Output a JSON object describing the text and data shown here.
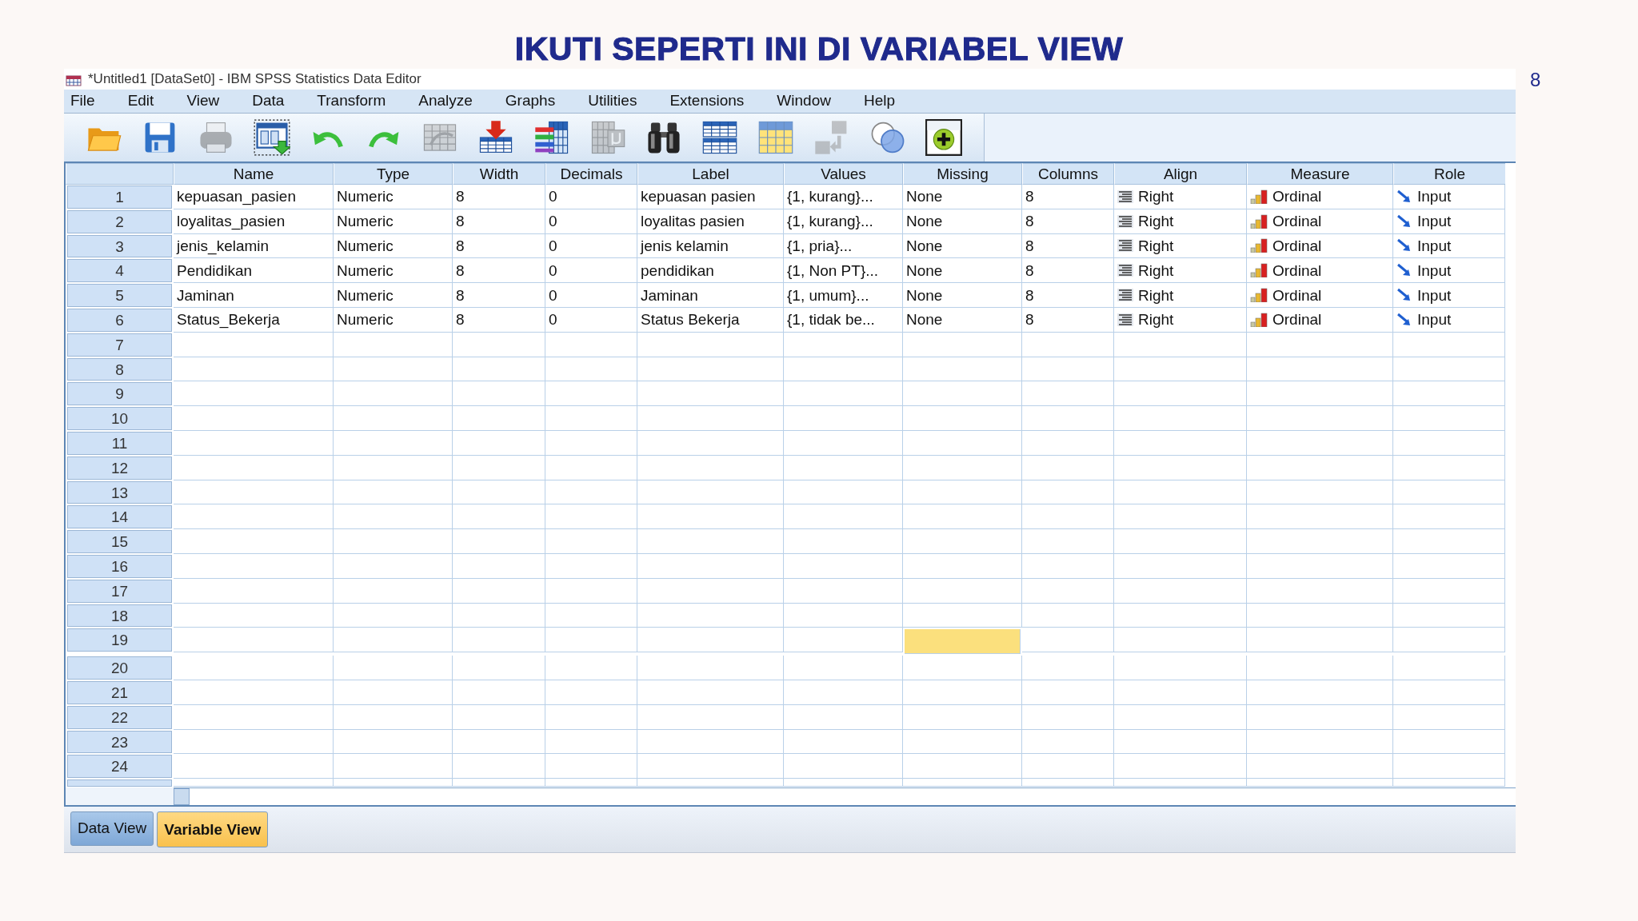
{
  "slide": {
    "heading": "IKUTI SEPERTI INI DI VARIABEL VIEW",
    "page_number": "8"
  },
  "window": {
    "title": "*Untitled1 [DataSet0] - IBM SPSS Statistics Data Editor"
  },
  "menu": [
    "File",
    "Edit",
    "View",
    "Data",
    "Transform",
    "Analyze",
    "Graphs",
    "Utilities",
    "Extensions",
    "Window",
    "Help"
  ],
  "toolbar": [
    {
      "kind": "open",
      "disabled": false
    },
    {
      "kind": "save",
      "disabled": false
    },
    {
      "kind": "print",
      "disabled": true
    },
    {
      "kind": "recall",
      "disabled": false
    },
    {
      "kind": "undo",
      "disabled": false
    },
    {
      "kind": "redo",
      "disabled": false
    },
    {
      "kind": "goto_case",
      "disabled": true
    },
    {
      "kind": "goto_variable",
      "disabled": false
    },
    {
      "kind": "variables",
      "disabled": false
    },
    {
      "kind": "attributes",
      "disabled": true
    },
    {
      "kind": "find",
      "disabled": false
    },
    {
      "kind": "insert_cases",
      "disabled": false
    },
    {
      "kind": "insert_variable",
      "disabled": false
    },
    {
      "kind": "split",
      "disabled": true
    },
    {
      "kind": "value_labels",
      "disabled": false
    },
    {
      "kind": "use_sets",
      "disabled": false
    }
  ],
  "grid": {
    "columns": [
      {
        "label": "Name",
        "kind": "text",
        "selected": false
      },
      {
        "label": "Type",
        "kind": "text",
        "selected": false
      },
      {
        "label": "Width",
        "kind": "text",
        "selected": false
      },
      {
        "label": "Decimals",
        "kind": "text",
        "selected": false
      },
      {
        "label": "Label",
        "kind": "text",
        "selected": false
      },
      {
        "label": "Values",
        "kind": "text",
        "selected": false
      },
      {
        "label": "Missing",
        "kind": "text",
        "selected": true
      },
      {
        "label": "Columns",
        "kind": "text",
        "selected": false
      },
      {
        "label": "Align",
        "kind": "align",
        "selected": false
      },
      {
        "label": "Measure",
        "kind": "measure",
        "selected": false
      },
      {
        "label": "Role",
        "kind": "role",
        "selected": false
      }
    ],
    "rows": [
      {
        "number": "1",
        "selected": false,
        "cells": [
          "kepuasan_pasien",
          "Numeric",
          "8",
          "0",
          "kepuasan pasien",
          "{1, kurang}...",
          "None",
          "8",
          "Right",
          "Ordinal",
          "Input"
        ]
      },
      {
        "number": "2",
        "selected": false,
        "cells": [
          "loyalitas_pasien",
          "Numeric",
          "8",
          "0",
          "loyalitas pasien",
          "{1, kurang}...",
          "None",
          "8",
          "Right",
          "Ordinal",
          "Input"
        ]
      },
      {
        "number": "3",
        "selected": false,
        "cells": [
          "jenis_kelamin",
          "Numeric",
          "8",
          "0",
          "jenis kelamin",
          "{1, pria}...",
          "None",
          "8",
          "Right",
          "Ordinal",
          "Input"
        ]
      },
      {
        "number": "4",
        "selected": false,
        "cells": [
          "Pendidikan",
          "Numeric",
          "8",
          "0",
          "pendidikan",
          "{1, Non PT}...",
          "None",
          "8",
          "Right",
          "Ordinal",
          "Input"
        ]
      },
      {
        "number": "5",
        "selected": false,
        "cells": [
          "Jaminan",
          "Numeric",
          "8",
          "0",
          "Jaminan",
          "{1, umum}...",
          "None",
          "8",
          "Right",
          "Ordinal",
          "Input"
        ]
      },
      {
        "number": "6",
        "selected": false,
        "cells": [
          "Status_Bekerja",
          "Numeric",
          "8",
          "0",
          "Status Bekerja",
          "{1, tidak be...",
          "None",
          "8",
          "Right",
          "Ordinal",
          "Input"
        ]
      },
      {
        "number": "7",
        "selected": false
      },
      {
        "number": "8",
        "selected": false
      },
      {
        "number": "9",
        "selected": false
      },
      {
        "number": "10",
        "selected": false
      },
      {
        "number": "11",
        "selected": false
      },
      {
        "number": "12",
        "selected": false
      },
      {
        "number": "13",
        "selected": false
      },
      {
        "number": "14",
        "selected": false
      },
      {
        "number": "15",
        "selected": false
      },
      {
        "number": "16",
        "selected": false
      },
      {
        "number": "17",
        "selected": false
      },
      {
        "number": "18",
        "selected": false
      },
      {
        "number": "19",
        "selected": true
      },
      {
        "number": "20",
        "selected": false
      },
      {
        "number": "21",
        "selected": false
      },
      {
        "number": "22",
        "selected": false
      },
      {
        "number": "23",
        "selected": false
      },
      {
        "number": "24",
        "selected": false
      }
    ]
  },
  "tabs": [
    {
      "label": "Data View",
      "selected": false
    },
    {
      "label": "Variable View",
      "selected": true
    }
  ]
}
